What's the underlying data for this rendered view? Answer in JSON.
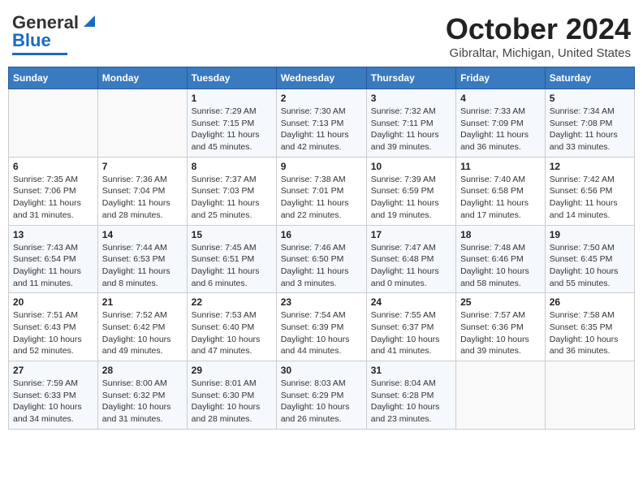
{
  "header": {
    "logo_line1": "General",
    "logo_line2": "Blue",
    "title": "October 2024",
    "subtitle": "Gibraltar, Michigan, United States"
  },
  "days_of_week": [
    "Sunday",
    "Monday",
    "Tuesday",
    "Wednesday",
    "Thursday",
    "Friday",
    "Saturday"
  ],
  "weeks": [
    [
      {
        "day": "",
        "sunrise": "",
        "sunset": "",
        "daylight": ""
      },
      {
        "day": "",
        "sunrise": "",
        "sunset": "",
        "daylight": ""
      },
      {
        "day": "1",
        "sunrise": "Sunrise: 7:29 AM",
        "sunset": "Sunset: 7:15 PM",
        "daylight": "Daylight: 11 hours and 45 minutes."
      },
      {
        "day": "2",
        "sunrise": "Sunrise: 7:30 AM",
        "sunset": "Sunset: 7:13 PM",
        "daylight": "Daylight: 11 hours and 42 minutes."
      },
      {
        "day": "3",
        "sunrise": "Sunrise: 7:32 AM",
        "sunset": "Sunset: 7:11 PM",
        "daylight": "Daylight: 11 hours and 39 minutes."
      },
      {
        "day": "4",
        "sunrise": "Sunrise: 7:33 AM",
        "sunset": "Sunset: 7:09 PM",
        "daylight": "Daylight: 11 hours and 36 minutes."
      },
      {
        "day": "5",
        "sunrise": "Sunrise: 7:34 AM",
        "sunset": "Sunset: 7:08 PM",
        "daylight": "Daylight: 11 hours and 33 minutes."
      }
    ],
    [
      {
        "day": "6",
        "sunrise": "Sunrise: 7:35 AM",
        "sunset": "Sunset: 7:06 PM",
        "daylight": "Daylight: 11 hours and 31 minutes."
      },
      {
        "day": "7",
        "sunrise": "Sunrise: 7:36 AM",
        "sunset": "Sunset: 7:04 PM",
        "daylight": "Daylight: 11 hours and 28 minutes."
      },
      {
        "day": "8",
        "sunrise": "Sunrise: 7:37 AM",
        "sunset": "Sunset: 7:03 PM",
        "daylight": "Daylight: 11 hours and 25 minutes."
      },
      {
        "day": "9",
        "sunrise": "Sunrise: 7:38 AM",
        "sunset": "Sunset: 7:01 PM",
        "daylight": "Daylight: 11 hours and 22 minutes."
      },
      {
        "day": "10",
        "sunrise": "Sunrise: 7:39 AM",
        "sunset": "Sunset: 6:59 PM",
        "daylight": "Daylight: 11 hours and 19 minutes."
      },
      {
        "day": "11",
        "sunrise": "Sunrise: 7:40 AM",
        "sunset": "Sunset: 6:58 PM",
        "daylight": "Daylight: 11 hours and 17 minutes."
      },
      {
        "day": "12",
        "sunrise": "Sunrise: 7:42 AM",
        "sunset": "Sunset: 6:56 PM",
        "daylight": "Daylight: 11 hours and 14 minutes."
      }
    ],
    [
      {
        "day": "13",
        "sunrise": "Sunrise: 7:43 AM",
        "sunset": "Sunset: 6:54 PM",
        "daylight": "Daylight: 11 hours and 11 minutes."
      },
      {
        "day": "14",
        "sunrise": "Sunrise: 7:44 AM",
        "sunset": "Sunset: 6:53 PM",
        "daylight": "Daylight: 11 hours and 8 minutes."
      },
      {
        "day": "15",
        "sunrise": "Sunrise: 7:45 AM",
        "sunset": "Sunset: 6:51 PM",
        "daylight": "Daylight: 11 hours and 6 minutes."
      },
      {
        "day": "16",
        "sunrise": "Sunrise: 7:46 AM",
        "sunset": "Sunset: 6:50 PM",
        "daylight": "Daylight: 11 hours and 3 minutes."
      },
      {
        "day": "17",
        "sunrise": "Sunrise: 7:47 AM",
        "sunset": "Sunset: 6:48 PM",
        "daylight": "Daylight: 11 hours and 0 minutes."
      },
      {
        "day": "18",
        "sunrise": "Sunrise: 7:48 AM",
        "sunset": "Sunset: 6:46 PM",
        "daylight": "Daylight: 10 hours and 58 minutes."
      },
      {
        "day": "19",
        "sunrise": "Sunrise: 7:50 AM",
        "sunset": "Sunset: 6:45 PM",
        "daylight": "Daylight: 10 hours and 55 minutes."
      }
    ],
    [
      {
        "day": "20",
        "sunrise": "Sunrise: 7:51 AM",
        "sunset": "Sunset: 6:43 PM",
        "daylight": "Daylight: 10 hours and 52 minutes."
      },
      {
        "day": "21",
        "sunrise": "Sunrise: 7:52 AM",
        "sunset": "Sunset: 6:42 PM",
        "daylight": "Daylight: 10 hours and 49 minutes."
      },
      {
        "day": "22",
        "sunrise": "Sunrise: 7:53 AM",
        "sunset": "Sunset: 6:40 PM",
        "daylight": "Daylight: 10 hours and 47 minutes."
      },
      {
        "day": "23",
        "sunrise": "Sunrise: 7:54 AM",
        "sunset": "Sunset: 6:39 PM",
        "daylight": "Daylight: 10 hours and 44 minutes."
      },
      {
        "day": "24",
        "sunrise": "Sunrise: 7:55 AM",
        "sunset": "Sunset: 6:37 PM",
        "daylight": "Daylight: 10 hours and 41 minutes."
      },
      {
        "day": "25",
        "sunrise": "Sunrise: 7:57 AM",
        "sunset": "Sunset: 6:36 PM",
        "daylight": "Daylight: 10 hours and 39 minutes."
      },
      {
        "day": "26",
        "sunrise": "Sunrise: 7:58 AM",
        "sunset": "Sunset: 6:35 PM",
        "daylight": "Daylight: 10 hours and 36 minutes."
      }
    ],
    [
      {
        "day": "27",
        "sunrise": "Sunrise: 7:59 AM",
        "sunset": "Sunset: 6:33 PM",
        "daylight": "Daylight: 10 hours and 34 minutes."
      },
      {
        "day": "28",
        "sunrise": "Sunrise: 8:00 AM",
        "sunset": "Sunset: 6:32 PM",
        "daylight": "Daylight: 10 hours and 31 minutes."
      },
      {
        "day": "29",
        "sunrise": "Sunrise: 8:01 AM",
        "sunset": "Sunset: 6:30 PM",
        "daylight": "Daylight: 10 hours and 28 minutes."
      },
      {
        "day": "30",
        "sunrise": "Sunrise: 8:03 AM",
        "sunset": "Sunset: 6:29 PM",
        "daylight": "Daylight: 10 hours and 26 minutes."
      },
      {
        "day": "31",
        "sunrise": "Sunrise: 8:04 AM",
        "sunset": "Sunset: 6:28 PM",
        "daylight": "Daylight: 10 hours and 23 minutes."
      },
      {
        "day": "",
        "sunrise": "",
        "sunset": "",
        "daylight": ""
      },
      {
        "day": "",
        "sunrise": "",
        "sunset": "",
        "daylight": ""
      }
    ]
  ]
}
